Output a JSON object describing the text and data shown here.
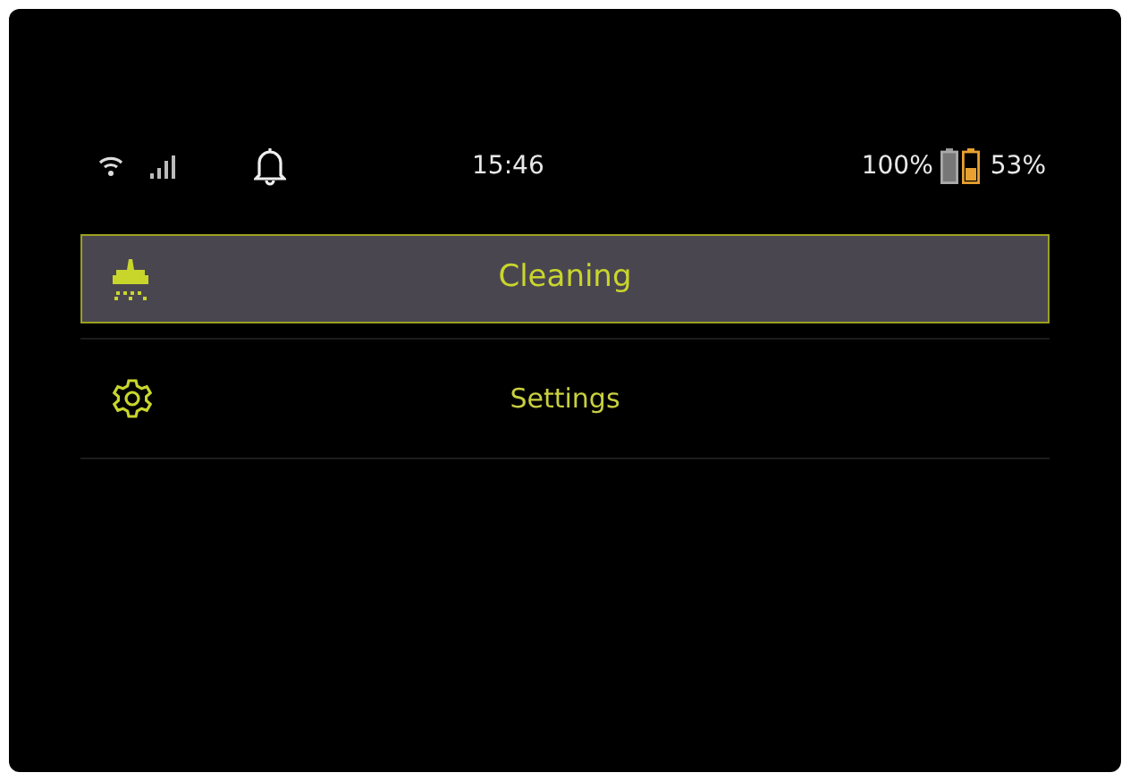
{
  "status_bar": {
    "time": "15:46",
    "battery_1": "100%",
    "battery_2": "53%"
  },
  "menu": [
    {
      "kind": "cleaning",
      "label": "Cleaning",
      "selected": true
    },
    {
      "kind": "settings",
      "label": "Settings",
      "selected": false
    }
  ]
}
